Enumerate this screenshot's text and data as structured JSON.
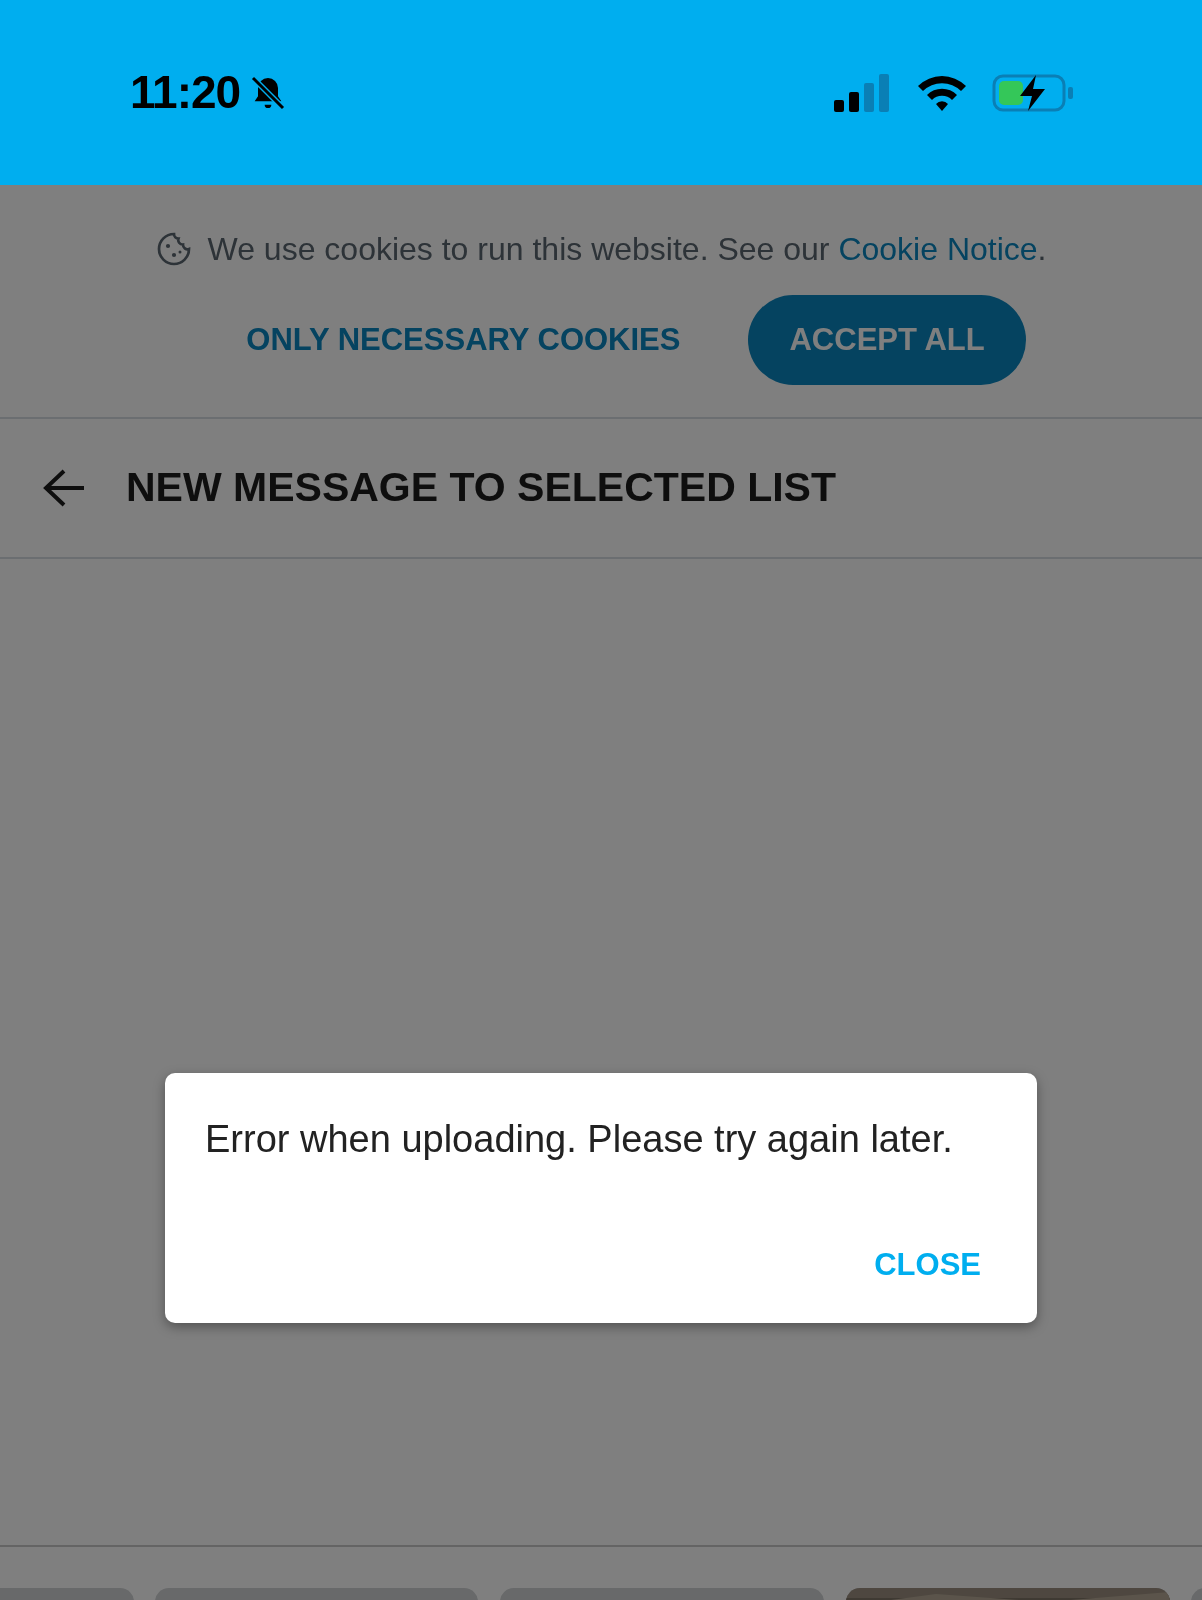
{
  "status_bar": {
    "time": "11:20"
  },
  "cookie_banner": {
    "text": "We use cookies to run this website. See our",
    "link": "Cookie Notice",
    "end": ".",
    "buttons": [
      {
        "label": "ONLY NECESSARY COOKIES",
        "kind": "text"
      },
      {
        "label": "ACCEPT ALL",
        "kind": "filled"
      }
    ]
  },
  "header": {
    "title": "NEW MESSAGE TO SELECTED LIST"
  },
  "dialog": {
    "message": "Error when uploading. Please try again later.",
    "action": "CLOSE"
  },
  "thumbnails": [
    {
      "kind": "blank"
    },
    {
      "kind": "blank"
    },
    {
      "kind": "blank"
    },
    {
      "kind": "picture"
    },
    {
      "kind": "blank"
    }
  ]
}
